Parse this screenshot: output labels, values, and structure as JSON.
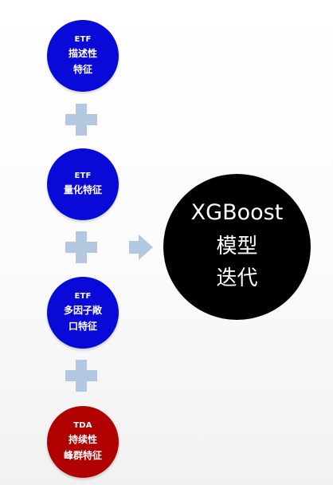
{
  "colors": {
    "feature_blue": "#0a0ad8",
    "feature_red": "#b00000",
    "plus": "#b4c7e0",
    "arrow": "#b4c7e0",
    "model": "#000000",
    "text": "#ffffff"
  },
  "features": [
    {
      "tag": "ETF",
      "lines": [
        "描述性",
        "特征"
      ]
    },
    {
      "tag": "ETF",
      "lines": [
        "量化特征"
      ]
    },
    {
      "tag": "ETF",
      "lines": [
        "多因子敞",
        "口特征"
      ]
    },
    {
      "tag": "TDA",
      "lines": [
        "持续性",
        "峰群特征"
      ]
    }
  ],
  "model": {
    "title": "XGBoost",
    "lines": [
      "模型",
      "迭代"
    ]
  }
}
